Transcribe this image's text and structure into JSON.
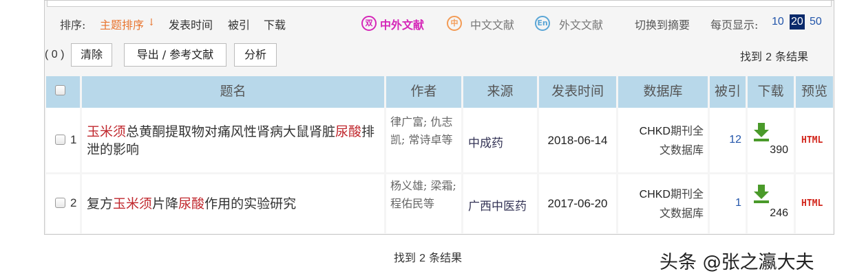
{
  "sort": {
    "label": "排序:",
    "options": [
      {
        "label": "主题排序",
        "active": true,
        "arrow": "↓"
      },
      {
        "label": "发表时间"
      },
      {
        "label": "被引"
      },
      {
        "label": "下载"
      }
    ]
  },
  "language": {
    "all": {
      "icon_text": "双",
      "label": "中外文献"
    },
    "chinese": {
      "icon_text": "中",
      "label": "中文文献"
    },
    "foreign": {
      "icon_text": "En",
      "label": "外文文献"
    }
  },
  "switch_label": "切换到摘要",
  "per_page": {
    "label": "每页显示:",
    "options": [
      "10",
      "20",
      "50"
    ],
    "selected": "20"
  },
  "actions": {
    "selected_count": "( 0 )",
    "clear": "清除",
    "export": "导出 / 参考文献",
    "analyze": "分析"
  },
  "found": {
    "prefix": "找到",
    "count": "2",
    "suffix": "条结果"
  },
  "table": {
    "headers": [
      "题名",
      "作者",
      "来源",
      "发表时间",
      "数据库",
      "被引",
      "下载",
      "预览"
    ],
    "rows": [
      {
        "index": "1",
        "title_parts": [
          {
            "t": "玉米须",
            "hl": true
          },
          {
            "t": "总黄酮提取物对痛风性肾病大鼠肾脏",
            "hl": false
          },
          {
            "t": "尿酸",
            "hl": true
          },
          {
            "t": "排泄的影响",
            "hl": false
          }
        ],
        "authors": "律广富; 仇志凯; 常诗卓等",
        "source": "中成药",
        "date": "2018-06-14",
        "database": {
          "latin": "CHKD",
          "line1": "期刊全",
          "line2": "文数据库"
        },
        "cited": "12",
        "downloads": "390",
        "preview": "HTML"
      },
      {
        "index": "2",
        "title_parts": [
          {
            "t": "复方",
            "hl": false
          },
          {
            "t": "玉米须",
            "hl": true
          },
          {
            "t": "片降",
            "hl": false
          },
          {
            "t": "尿酸",
            "hl": true
          },
          {
            "t": "作用的实验研究",
            "hl": false
          }
        ],
        "authors": "杨义雄; 梁霜; 程佑民等",
        "source": "广西中医药",
        "date": "2017-06-20",
        "database": {
          "latin": "CHKD",
          "line1": "期刊全",
          "line2": "文数据库"
        },
        "cited": "1",
        "downloads": "246",
        "preview": "HTML"
      }
    ]
  },
  "watermark": "头条 @张之瀛大夫",
  "colors": {
    "accent_orange": "#e8742e",
    "header_blue": "#b8d8ea",
    "highlight_red": "#c0272d",
    "link_blue": "#2255aa",
    "download_green": "#4a9a2a"
  }
}
